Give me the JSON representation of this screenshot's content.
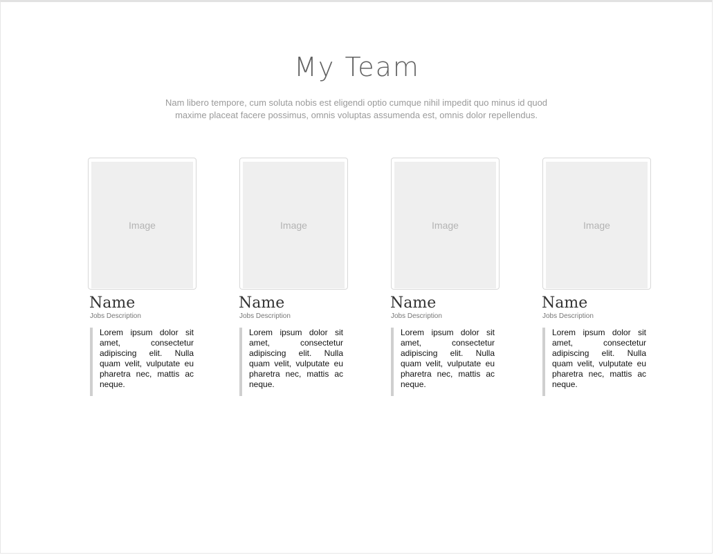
{
  "header": {
    "title": "My Team",
    "subtitle": "Nam libero tempore, cum soluta nobis est eligendi optio cumque nihil impedit quo minus id quod maxime placeat facere possimus, omnis voluptas assumenda est, omnis dolor repellendus."
  },
  "team": [
    {
      "image_label": "Image",
      "name": "Name",
      "job": "Jobs Description",
      "bio": "Lorem ipsum dolor sit amet, consectetur adipiscing elit. Nulla quam velit, vulputate eu pharetra nec, mattis ac neque."
    },
    {
      "image_label": "Image",
      "name": "Name",
      "job": "Jobs Description",
      "bio": "Lorem ipsum dolor sit amet, consectetur adipiscing elit. Nulla quam velit, vulputate eu pharetra nec, mattis ac neque."
    },
    {
      "image_label": "Image",
      "name": "Name",
      "job": "Jobs Description",
      "bio": "Lorem ipsum dolor sit amet, consectetur adipiscing elit. Nulla quam velit, vulputate eu pharetra nec, mattis ac neque."
    },
    {
      "image_label": "Image",
      "name": "Name",
      "job": "Jobs Description",
      "bio": "Lorem ipsum dolor sit amet, consectetur adipiscing elit. Nulla quam velit, vulputate eu pharetra nec, mattis ac neque."
    }
  ]
}
